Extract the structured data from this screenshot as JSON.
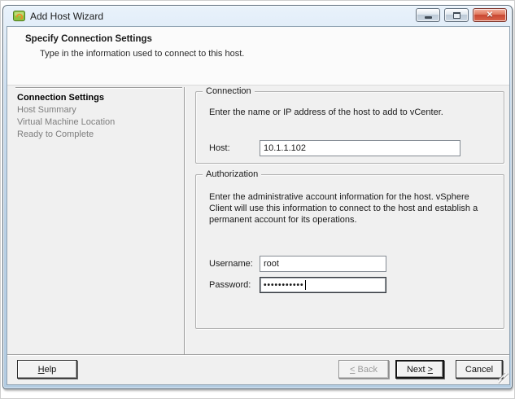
{
  "window": {
    "title": "Add Host Wizard",
    "icon": "wizard-green-icon",
    "controls": {
      "close_glyph": "✕"
    }
  },
  "header": {
    "title": "Specify Connection Settings",
    "subtitle": "Type in the information used to connect to this host."
  },
  "sidebar": {
    "items": [
      {
        "label": "Connection Settings",
        "active": true
      },
      {
        "label": "Host Summary",
        "active": false
      },
      {
        "label": "Virtual Machine Location",
        "active": false
      },
      {
        "label": "Ready to Complete",
        "active": false
      }
    ]
  },
  "connection": {
    "legend": "Connection",
    "instruction": "Enter the name or IP address of the host to add to vCenter.",
    "host_label": "Host:",
    "host_value": "10.1.1.102"
  },
  "authorization": {
    "legend": "Authorization",
    "instruction": "Enter the administrative account information for the host. vSphere Client will use this information to connect to the host and establish a permanent account for its operations.",
    "username_label": "Username:",
    "username_value": "root",
    "password_label": "Password:",
    "password_value": "•••••••••••"
  },
  "footer": {
    "help": {
      "key": "H",
      "rest": "elp"
    },
    "back": {
      "key": "<",
      "rest": " Back"
    },
    "next": {
      "pre": "Next ",
      "key": ">"
    },
    "cancel_label": "Cancel"
  },
  "colors": {
    "titlebar": "#c3d8ec",
    "close_button": "#c84732",
    "client_bg": "#f0f0f0",
    "active_text": "#000000",
    "inactive_text": "#7e7e7e"
  }
}
